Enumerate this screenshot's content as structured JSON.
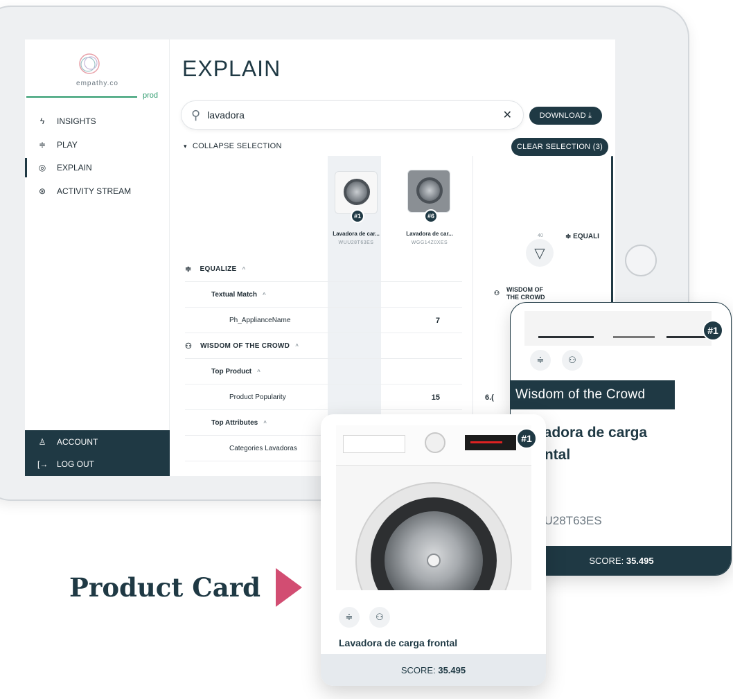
{
  "app": {
    "brand": "empathy.co",
    "environment": "prod",
    "page_title": "EXPLAIN"
  },
  "sidebar": {
    "items": [
      {
        "label": "INSIGHTS",
        "icon": "bolt-icon"
      },
      {
        "label": "PLAY",
        "icon": "sliders-icon"
      },
      {
        "label": "EXPLAIN",
        "icon": "eye-icon",
        "active": true
      },
      {
        "label": "ACTIVITY STREAM",
        "icon": "activity-icon"
      }
    ],
    "bottom": [
      {
        "label": "ACCOUNT",
        "icon": "account-icon"
      },
      {
        "label": "LOG OUT",
        "icon": "logout-icon"
      }
    ]
  },
  "search": {
    "value": "lavadora"
  },
  "buttons": {
    "download": "DOWNLOAD ⤓",
    "clear_selection": "CLEAR SELECTION (3)",
    "collapse": "COLLAPSE SELECTION"
  },
  "products": [
    {
      "rank": "#1",
      "name": "Lavadora de car...",
      "sku": "WUU28T63ES"
    },
    {
      "rank": "#6",
      "name": "Lavadora de car...",
      "sku": "WGG14Z0XES"
    }
  ],
  "table": {
    "rows": [
      {
        "type": "section",
        "label": "EQUALIZE"
      },
      {
        "type": "sub",
        "label": "Textual Match"
      },
      {
        "type": "leaf",
        "label": "Ph_ApplianceName",
        "v1": "7",
        "v2": ""
      },
      {
        "type": "section",
        "label": "WISDOM OF THE CROWD"
      },
      {
        "type": "sub",
        "label": "Top Product"
      },
      {
        "type": "leaf",
        "label": "Product Popularity",
        "v1": "15",
        "v2": "6.("
      },
      {
        "type": "sub",
        "label": "Top Attributes"
      },
      {
        "type": "leaf",
        "label": "Categories Lavadoras",
        "v1": "",
        "v2": ""
      }
    ]
  },
  "right_panel": {
    "count": "40",
    "equalize": "EQUALI",
    "woc_line1": "WISDOM OF",
    "woc_line2": "THE CROWD"
  },
  "card_big": {
    "rank": "#1",
    "tooltip": "Wisdom of the Crowd",
    "name_line1": "vadora de carga",
    "name_line2": "ontal",
    "sku": "JU28T63ES",
    "score_label": "SCORE:",
    "score_value": "35.495"
  },
  "card_small": {
    "rank": "#1",
    "name": "Lavadora de carga frontal",
    "score_label": "SCORE:",
    "score_value": "35.495"
  },
  "annotation": {
    "label": "Product Card"
  },
  "colors": {
    "primary": "#1f3944",
    "accent": "#d24d72",
    "env": "#2f9b6e"
  }
}
